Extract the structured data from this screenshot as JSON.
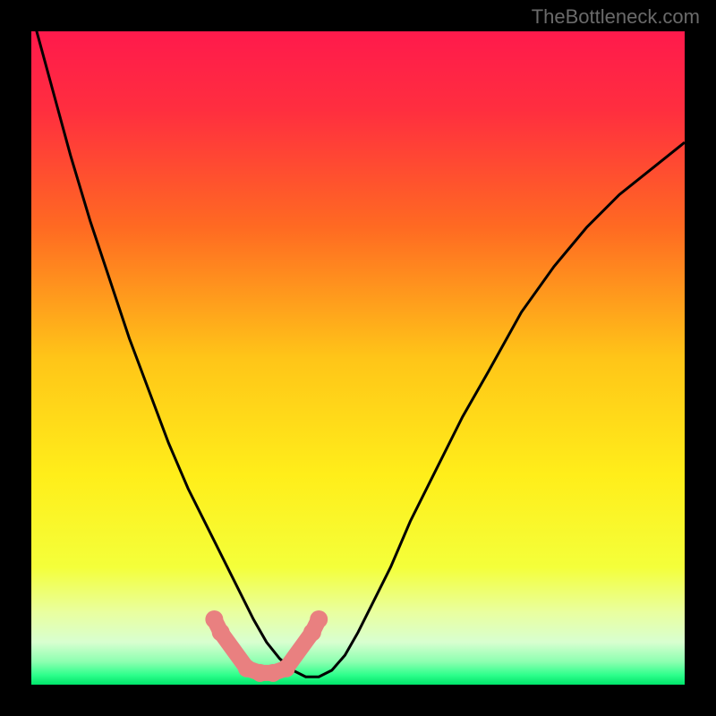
{
  "watermark": "TheBottleneck.com",
  "chart_data": {
    "type": "line",
    "title": "",
    "xlabel": "",
    "ylabel": "",
    "xlim": [
      0,
      100
    ],
    "ylim": [
      0,
      100
    ],
    "gradient_stops": [
      {
        "offset": 0.0,
        "color": "#ff1a4c"
      },
      {
        "offset": 0.12,
        "color": "#ff2e3f"
      },
      {
        "offset": 0.3,
        "color": "#ff6a22"
      },
      {
        "offset": 0.5,
        "color": "#ffc518"
      },
      {
        "offset": 0.68,
        "color": "#ffee1a"
      },
      {
        "offset": 0.82,
        "color": "#f4ff3a"
      },
      {
        "offset": 0.89,
        "color": "#e9ffa0"
      },
      {
        "offset": 0.935,
        "color": "#d8ffd0"
      },
      {
        "offset": 0.965,
        "color": "#8cffb0"
      },
      {
        "offset": 0.985,
        "color": "#2fff8c"
      },
      {
        "offset": 1.0,
        "color": "#00e56a"
      }
    ],
    "series": [
      {
        "name": "curve",
        "color": "#000000",
        "x": [
          0,
          3,
          6,
          9,
          12,
          15,
          18,
          21,
          24,
          27,
          30,
          32,
          34,
          36,
          38,
          40,
          42,
          44,
          46,
          48,
          50,
          52,
          55,
          58,
          62,
          66,
          70,
          75,
          80,
          85,
          90,
          95,
          100
        ],
        "y": [
          103,
          92,
          81,
          71,
          62,
          53,
          45,
          37,
          30,
          24,
          18,
          14,
          10,
          6.5,
          4,
          2.2,
          1.2,
          1.2,
          2.2,
          4.5,
          8,
          12,
          18,
          25,
          33,
          41,
          48,
          57,
          64,
          70,
          75,
          79,
          83
        ]
      }
    ],
    "markers": {
      "name": "highlight-points",
      "color": "#e98080",
      "points": [
        {
          "x": 28,
          "y": 10
        },
        {
          "x": 29,
          "y": 8
        },
        {
          "x": 33,
          "y": 2.5
        },
        {
          "x": 35,
          "y": 1.8
        },
        {
          "x": 37,
          "y": 1.8
        },
        {
          "x": 39,
          "y": 2.5
        },
        {
          "x": 43,
          "y": 8
        },
        {
          "x": 44,
          "y": 10
        }
      ]
    }
  }
}
